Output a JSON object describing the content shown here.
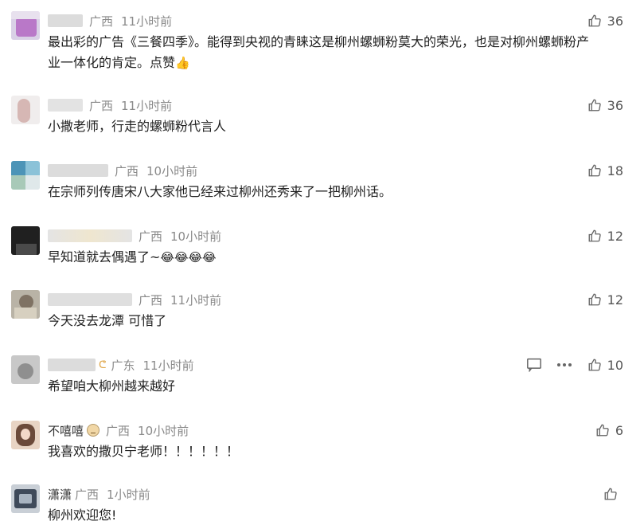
{
  "comments": [
    {
      "name": "",
      "badge": "",
      "location": "广西",
      "time": "11小时前",
      "text": "最出彩的广告《三餐四季》。能得到央视的青睐这是柳州螺蛳粉莫大的荣光，也是对柳州螺蛳粉产业一体化的肯定。点赞",
      "emoji": "👍",
      "likes": "36"
    },
    {
      "name": "",
      "badge": "",
      "location": "广西",
      "time": "11小时前",
      "text": "小撒老师，行走的螺蛳粉代言人",
      "emoji": "",
      "likes": "36"
    },
    {
      "name": "",
      "badge": "",
      "location": "广西",
      "time": "10小时前",
      "text": "在宗师列传唐宋八大家他已经来过柳州还秀来了一把柳州话。",
      "emoji": "",
      "likes": "18"
    },
    {
      "name": "",
      "badge": "",
      "location": "广西",
      "time": "10小时前",
      "text": "早知道就去偶遇了~",
      "emoji": "😂😂😂😂",
      "likes": "12"
    },
    {
      "name": "",
      "badge": "",
      "location": "广西",
      "time": "11小时前",
      "text": "今天没去龙潭 可惜了",
      "emoji": "",
      "likes": "12"
    },
    {
      "name": "",
      "badge": "ᕦ",
      "location": "广东",
      "time": "11小时前",
      "text": "希望咱大柳州越来越好",
      "emoji": "",
      "likes": "10"
    },
    {
      "name": "不嘻嘻",
      "badge": "",
      "location": "广西",
      "time": "10小时前",
      "text": "我喜欢的撒贝宁老师！！！！！！",
      "emoji": "",
      "likes": "6"
    },
    {
      "name": "潇潇",
      "badge": "",
      "location": "广西",
      "time": "1小时前",
      "text": "柳州欢迎您!",
      "emoji": "",
      "likes": ""
    }
  ],
  "icons": {
    "like": "thumbs-up-icon",
    "reply": "comment-icon",
    "more": "more-icon"
  },
  "colors": {
    "meta_gray": "#8a8a8a",
    "icon_gray": "#666666",
    "text": "#1f1f1f"
  }
}
